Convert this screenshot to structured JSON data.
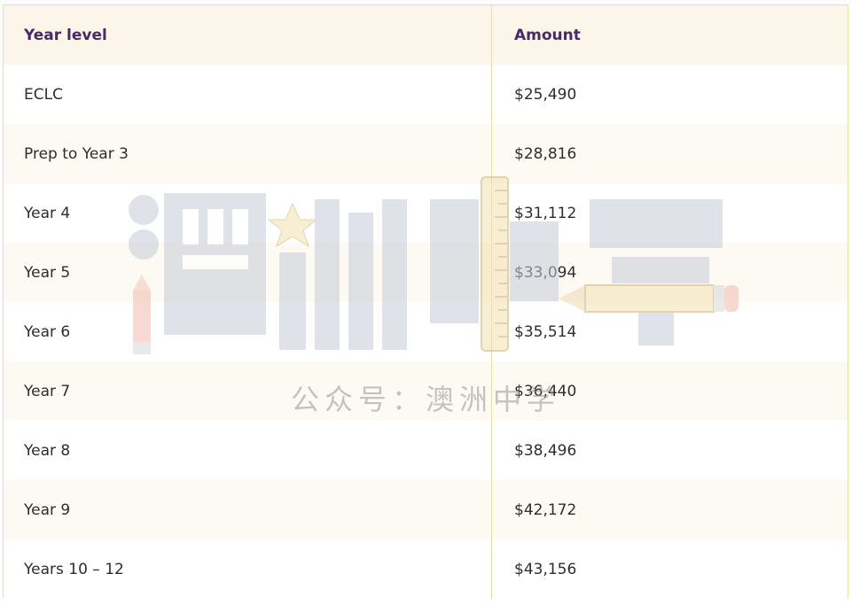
{
  "table": {
    "headers": {
      "year_level": "Year level",
      "amount": "Amount"
    },
    "rows": [
      {
        "year_level": "ECLC",
        "amount": "$25,490"
      },
      {
        "year_level": "Prep to Year 3",
        "amount": "$28,816"
      },
      {
        "year_level": "Year 4",
        "amount": "$31,112"
      },
      {
        "year_level": "Year 5",
        "amount": "$33,094"
      },
      {
        "year_level": "Year 6",
        "amount": "$35,514"
      },
      {
        "year_level": "Year 7",
        "amount": "$36,440"
      },
      {
        "year_level": "Year 8",
        "amount": "$38,496"
      },
      {
        "year_level": "Year 9",
        "amount": "$42,172"
      },
      {
        "year_level": "Years 10 – 12",
        "amount": "$43,156"
      }
    ]
  },
  "watermark": {
    "logo_text": "澳洲中学",
    "caption": "公众号：澳洲中学"
  },
  "colors": {
    "header_background": "#fcf6ea",
    "header_text": "#4a2a63",
    "body_text": "#2d2d2d",
    "border": "#ecdcb0"
  }
}
